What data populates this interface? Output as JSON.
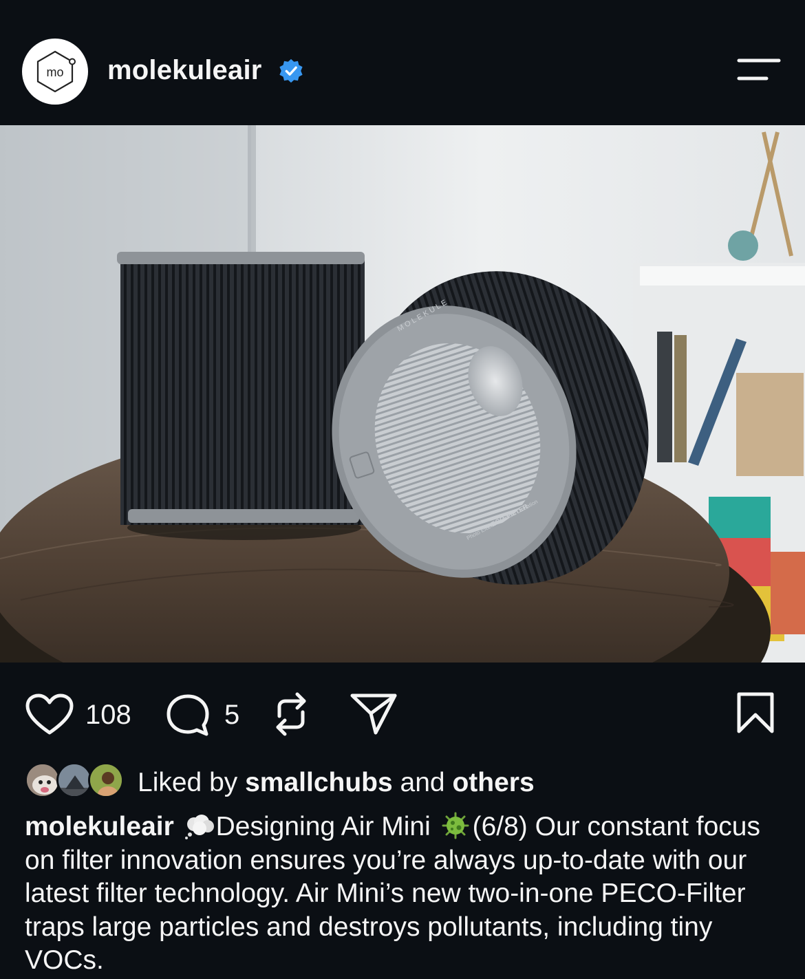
{
  "header": {
    "avatar_text": "mo",
    "username": "molekuleair",
    "verified": true
  },
  "post": {
    "image_alt": "Two Molekule Air Mini PECO-Filter cartridges on a round wooden side table",
    "filter_ring_text_top": "MOLEKULE",
    "filter_ring_text_bottom_1": "PECO-FILTER",
    "filter_ring_text_bottom_2": "Photo Electrochemical Oxidation"
  },
  "actions": {
    "like_count": "108",
    "comment_count": "5"
  },
  "likes": {
    "prefix": "Liked by ",
    "user": "smallchubs",
    "middle": " and ",
    "others": "others"
  },
  "caption": {
    "username": "molekuleair",
    "emoji_1": "thought-balloon",
    "part_1": "Designing Air Mini",
    "emoji_2": "microbe",
    "part_2": "(6/8) Our constant focus on filter innovation ensures you’re always up-to-date with our latest filter technology. Air Mini’s new two-in-one PECO-Filter traps large particles and destroys pollutants, including tiny VOCs."
  },
  "colors": {
    "background": "#0b0f14",
    "text": "#f5f5f5",
    "verified_blue": "#3897f0"
  }
}
